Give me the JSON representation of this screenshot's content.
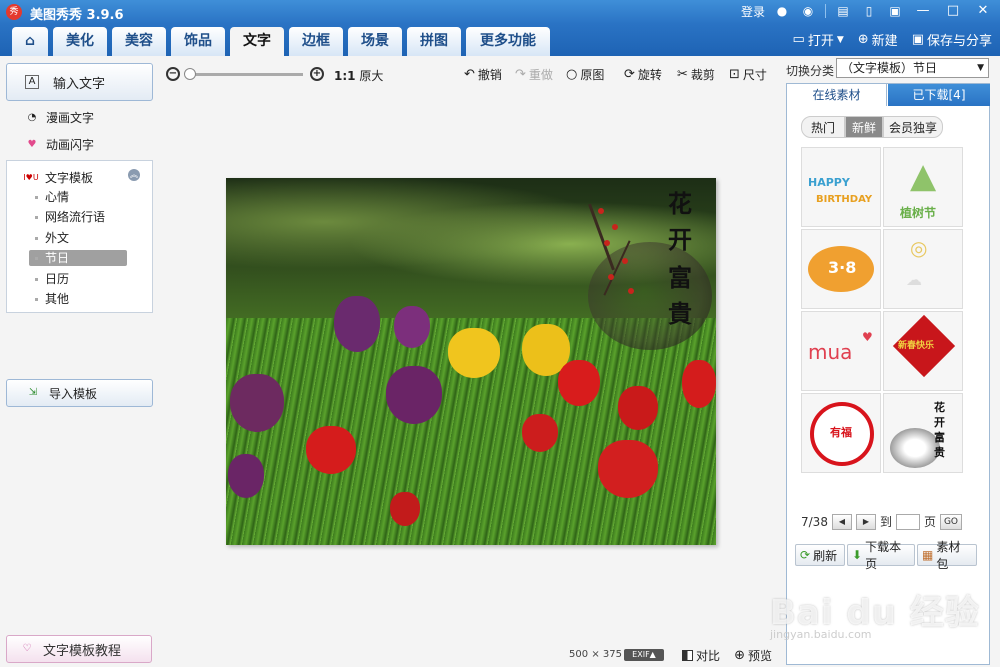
{
  "titlebar": {
    "app_title": "美图秀秀 3.9.6",
    "logo_text": "秀",
    "login": "登录"
  },
  "tabs": {
    "home": "⌂",
    "items": [
      "美化",
      "美容",
      "饰品",
      "文字",
      "边框",
      "场景",
      "拼图",
      "更多功能"
    ],
    "active": "文字"
  },
  "actions": {
    "open": "打开",
    "new": "新建",
    "save": "保存与分享"
  },
  "left": {
    "input_text": "输入文字",
    "manga_text": "漫画文字",
    "anim_text": "动画闪字",
    "template_title": "文字模板",
    "template_items": [
      "心情",
      "网络流行语",
      "外文",
      "节日",
      "日历",
      "其他"
    ],
    "selected_item": "节日",
    "import": "导入模板",
    "tutorial": "文字模板教程"
  },
  "toolbar": {
    "one_to_one": "1:1",
    "original_size": "原大",
    "undo": "撤销",
    "redo": "重做",
    "original": "原图",
    "rotate": "旋转",
    "crop": "裁剪",
    "resize": "尺寸"
  },
  "zoom": {
    "level": 0.0
  },
  "photo": {
    "overlay_chars": [
      "花",
      "开",
      "富",
      "貴"
    ]
  },
  "status": {
    "width": "500",
    "times": "×",
    "height": "375",
    "exif": "EXIF▲",
    "compare": "对比",
    "preview": "预览"
  },
  "right": {
    "switch_label": "切换分类",
    "category": "（文字模板）节日",
    "tab_online": "在线素材",
    "tab_downloaded": "已下载[4]",
    "filter": [
      "热门",
      "新鲜",
      "会员独享"
    ],
    "active_filter": "新鲜",
    "thumbs": {
      "happy_birthday": [
        "HAPPY",
        "BIRTHDAY"
      ],
      "tree_text": "植树节",
      "num38": "3·8",
      "mua": "mua",
      "xinchun": "新春快乐",
      "fu_text": "有福",
      "huakai": "花开富贵"
    },
    "pager": {
      "page": "7/38",
      "to": "到",
      "page_unit": "页",
      "go": "GO",
      "input_value": ""
    },
    "refresh": "刷新",
    "download_page": "下载本页",
    "package": "素材包"
  },
  "watermark": {
    "main": "Bai du 经验",
    "sub": "jingyan.baidu.com"
  }
}
